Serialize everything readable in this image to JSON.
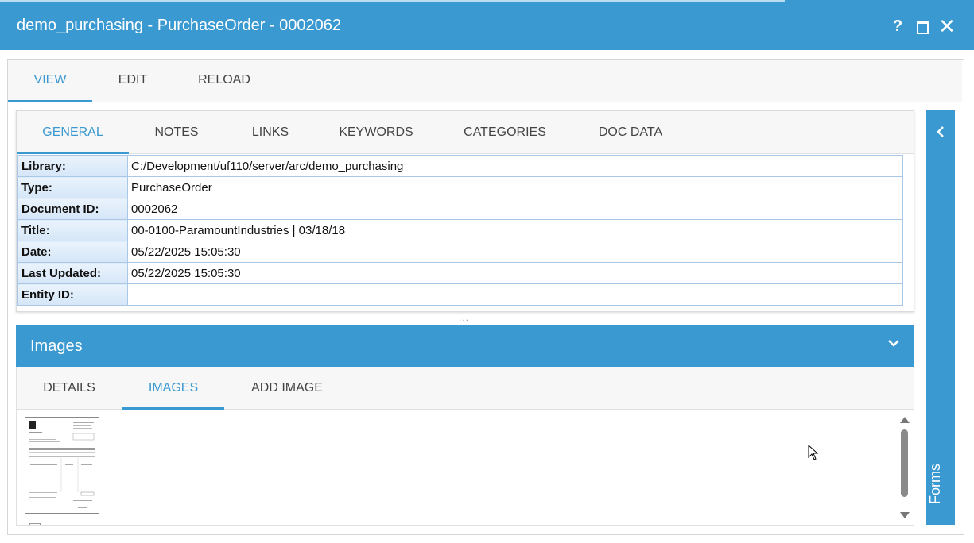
{
  "window": {
    "title": "demo_purchasing - PurchaseOrder - 0002062",
    "help_label": "?",
    "close_label": "✕"
  },
  "top_tabs": [
    {
      "label": "VIEW",
      "active": true
    },
    {
      "label": "EDIT",
      "active": false
    },
    {
      "label": "RELOAD",
      "active": false
    }
  ],
  "general": {
    "tabs": [
      {
        "label": "GENERAL",
        "active": true
      },
      {
        "label": "NOTES",
        "active": false
      },
      {
        "label": "LINKS",
        "active": false
      },
      {
        "label": "KEYWORDS",
        "active": false
      },
      {
        "label": "CATEGORIES",
        "active": false
      },
      {
        "label": "DOC DATA",
        "active": false
      }
    ],
    "properties": [
      {
        "key": "Library:",
        "value": "C:/Development/uf110/server/arc/demo_purchasing"
      },
      {
        "key": "Type:",
        "value": "PurchaseOrder"
      },
      {
        "key": "Document ID:",
        "value": "0002062"
      },
      {
        "key": "Title:",
        "value": "00-0100-ParamountIndustries | 03/18/18"
      },
      {
        "key": "Date:",
        "value": "05/22/2025 15:05:30"
      },
      {
        "key": "Last Updated:",
        "value": "05/22/2025 15:05:30"
      },
      {
        "key": "Entity ID:",
        "value": ""
      }
    ]
  },
  "splitter": "...",
  "images": {
    "title": "Images",
    "tabs": [
      {
        "label": "DETAILS",
        "active": false
      },
      {
        "label": "IMAGES",
        "active": true
      },
      {
        "label": "ADD IMAGE",
        "active": false
      }
    ]
  },
  "sidebar": {
    "label": "Forms"
  },
  "colors": {
    "accent": "#3a99d0",
    "property_key_bg": "#dbe9f8",
    "property_border": "#a9c7e6"
  }
}
